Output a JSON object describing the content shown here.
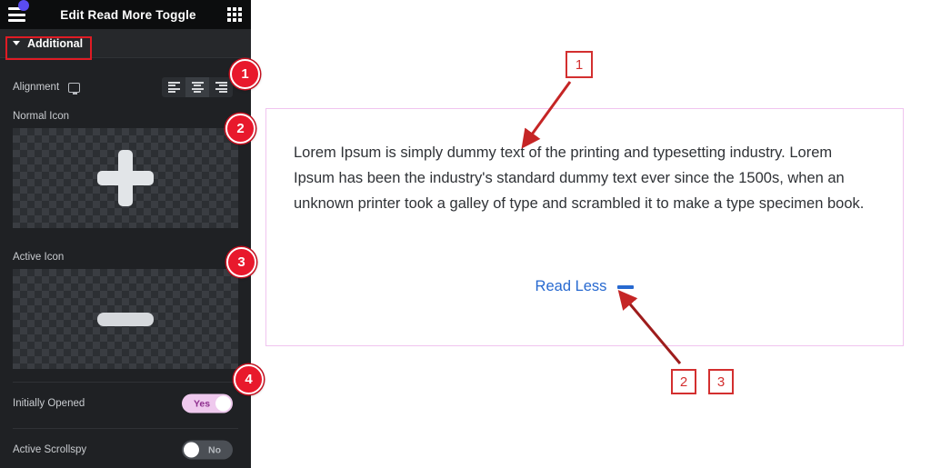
{
  "panel": {
    "title": "Edit Read More Toggle",
    "menu_icon": "hamburger-icon",
    "grid_icon": "apps-grid-icon",
    "section": {
      "label": "Additional",
      "expanded": true
    },
    "alignment": {
      "label": "Alignment",
      "device_icon": "desktop-monitor-icon",
      "options": [
        "align-left",
        "align-center",
        "align-right"
      ],
      "selected": "align-center"
    },
    "normal_icon": {
      "label": "Normal Icon",
      "glyph": "plus-icon"
    },
    "active_icon": {
      "label": "Active Icon",
      "glyph": "minus-icon"
    },
    "initially_opened": {
      "label": "Initially Opened",
      "value": "Yes",
      "state": "on"
    },
    "active_scrollspy": {
      "label": "Active Scrollspy",
      "value": "No",
      "state": "off"
    }
  },
  "badges": [
    {
      "number": "1"
    },
    {
      "number": "2"
    },
    {
      "number": "3"
    },
    {
      "number": "4"
    }
  ],
  "canvas": {
    "body_text": "Lorem Ipsum is simply dummy text of the printing and typesetting industry. Lorem Ipsum has been the industry's standard dummy text ever since the 1500s, when an unknown printer took a galley of type and scrambled it to make a type specimen book.",
    "read_less_label": "Read Less",
    "read_less_icon": "minus-icon",
    "border_color": "#f0c4ef",
    "link_color": "#2769d0"
  },
  "annotations": {
    "box_1": "1",
    "box_2": "2",
    "box_3": "3",
    "marker_color": "#d32f2f"
  }
}
